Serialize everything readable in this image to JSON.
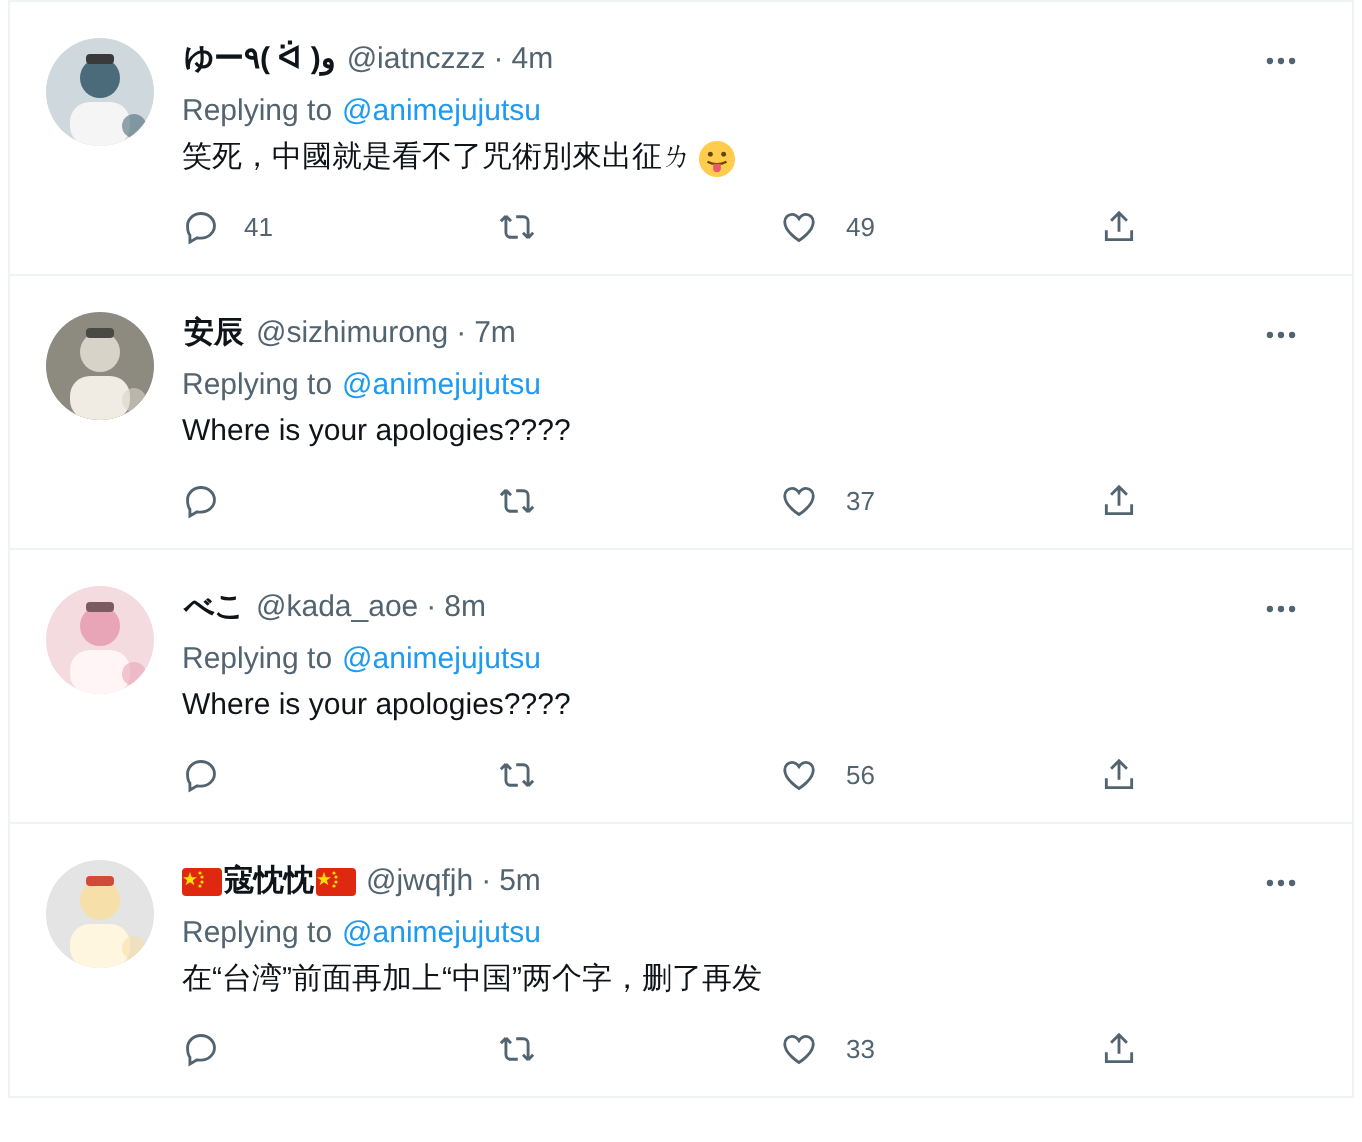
{
  "replies": [
    {
      "name": "ゆー٩( ᐛ )و",
      "flags": false,
      "handle": "@iatnczzz",
      "separator": "·",
      "time": "4m",
      "replying_label": "Replying to",
      "replying_to": "@animejujutsu",
      "text": "笑死，中國就是看不了咒術別來出征ㄌ",
      "emoji": true,
      "counts": {
        "replies": "41",
        "likes": "49"
      }
    },
    {
      "name": "安辰",
      "flags": false,
      "handle": "@sizhimurong",
      "separator": "·",
      "time": "7m",
      "replying_label": "Replying to",
      "replying_to": "@animejujutsu",
      "text": "Where is your apologies????",
      "emoji": false,
      "counts": {
        "likes": "37"
      }
    },
    {
      "name": "べこ",
      "flags": false,
      "handle": "@kada_aoe",
      "separator": "·",
      "time": "8m",
      "replying_label": "Replying to",
      "replying_to": "@animejujutsu",
      "text": "Where is your apologies????",
      "emoji": false,
      "counts": {
        "likes": "56"
      }
    },
    {
      "name": "寇忱忱",
      "flags": true,
      "handle": "@jwqfjh",
      "separator": "·",
      "time": "5m",
      "replying_label": "Replying to",
      "replying_to": "@animejujutsu",
      "text": "在“台湾”前面再加上“中国”两个字，删了再发",
      "emoji": false,
      "counts": {
        "likes": "33"
      }
    }
  ]
}
